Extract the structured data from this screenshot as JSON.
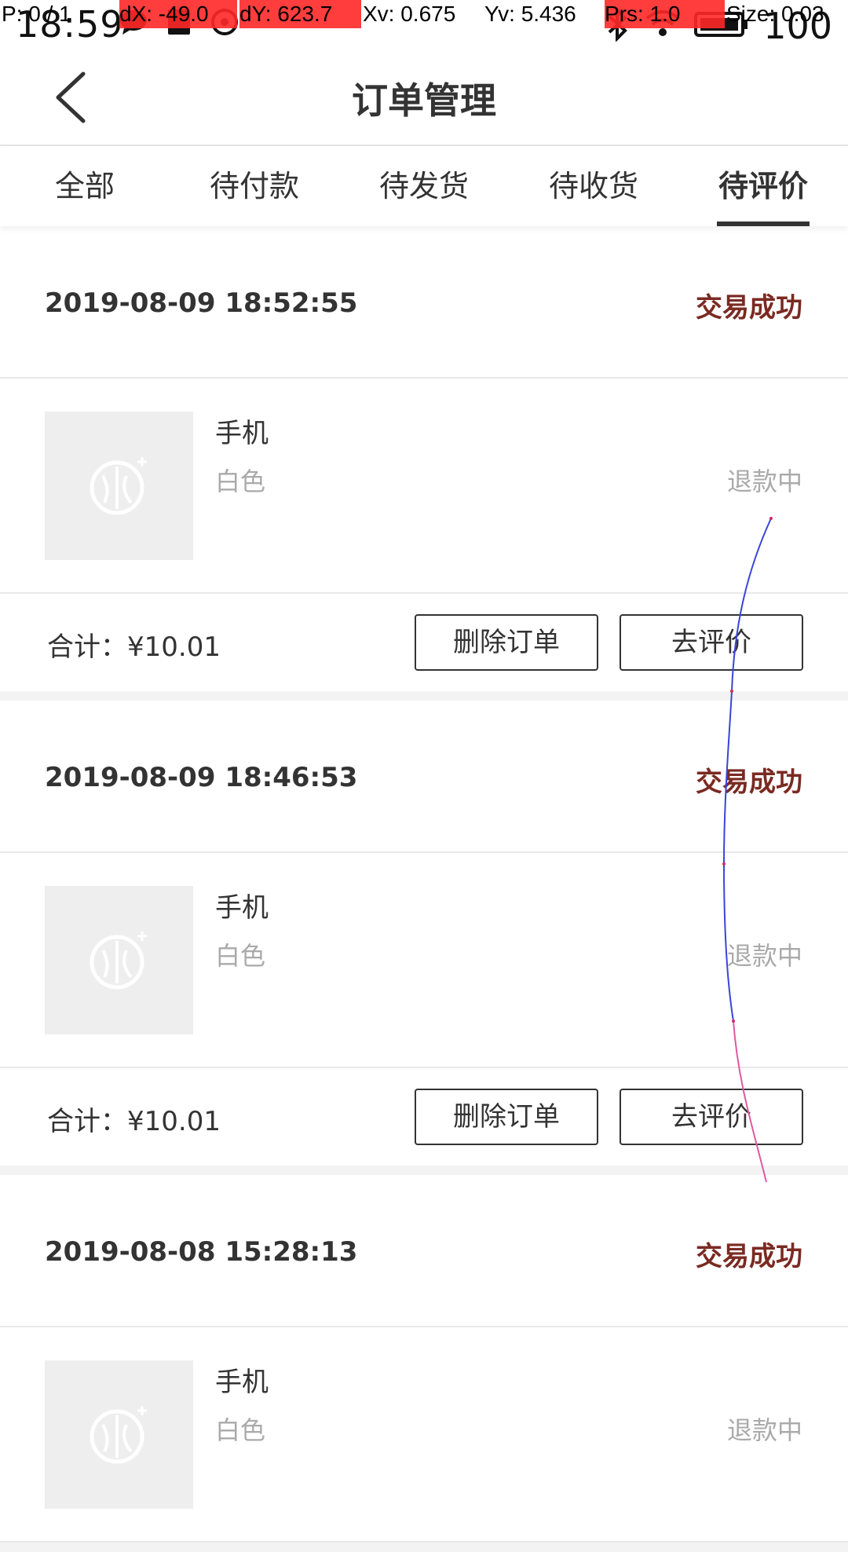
{
  "debug_overlay": {
    "pointer": "P: 0 / 1",
    "dx": "dX: -49.0",
    "dy": "dY: 623.7",
    "xv": "Xv: 0.675",
    "yv": "Yv: 5.436",
    "prs": "Prs: 1.0",
    "size": "Size: 0.03"
  },
  "status_bar": {
    "time": "18:59",
    "battery": "100"
  },
  "header": {
    "title": "订单管理"
  },
  "tabs": [
    {
      "label": "全部",
      "active": false
    },
    {
      "label": "待付款",
      "active": false
    },
    {
      "label": "待发货",
      "active": false
    },
    {
      "label": "待收货",
      "active": false
    },
    {
      "label": "待评价",
      "active": true
    }
  ],
  "orders": [
    {
      "datetime": "2019-08-09 18:52:55",
      "status": "交易成功",
      "item_name": "手机",
      "item_spec": "白色",
      "item_state": "退款中",
      "total": "合计：¥10.01",
      "delete_label": "删除订单",
      "review_label": "去评价"
    },
    {
      "datetime": "2019-08-09 18:46:53",
      "status": "交易成功",
      "item_name": "手机",
      "item_spec": "白色",
      "item_state": "退款中",
      "total": "合计：¥10.01",
      "delete_label": "删除订单",
      "review_label": "去评价"
    },
    {
      "datetime": "2019-08-08 15:28:13",
      "status": "交易成功",
      "item_name": "手机",
      "item_spec": "白色",
      "item_state": "退款中",
      "total": "",
      "delete_label": "",
      "review_label": ""
    }
  ],
  "colors": {
    "status_success": "#7a2a22",
    "muted_text": "#aaaaaa",
    "thumb_bg": "#eeeeee",
    "overlay_red": "#ff2828"
  },
  "icons": [
    "back-arrow-icon",
    "product-placeholder-icon",
    "bluetooth-icon",
    "wifi-icon",
    "battery-icon",
    "message-icon",
    "gesture-trace"
  ]
}
